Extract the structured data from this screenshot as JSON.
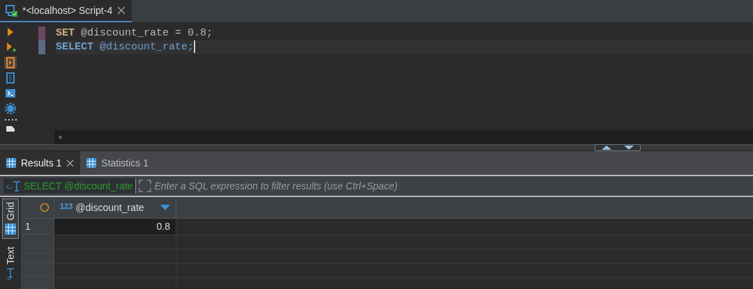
{
  "editor_tab": {
    "title": "*<localhost> Script-4",
    "selected": true
  },
  "code_lines": [
    {
      "current": false,
      "tokens": [
        {
          "kind": "keyword",
          "text": "SET"
        },
        {
          "kind": "text",
          "text": " @discount_rate = 0.8;"
        }
      ]
    },
    {
      "current": true,
      "tokens": [
        {
          "kind": "keyword",
          "text": "SELECT"
        },
        {
          "kind": "text",
          "text": " @discount_rate;"
        }
      ]
    }
  ],
  "result_tabs": [
    {
      "label": "Results 1",
      "selected": true
    },
    {
      "label": "Statistics 1",
      "selected": false
    }
  ],
  "filter": {
    "query": "SELECT @discount_rate",
    "placeholder": "Enter a SQL expression to filter results (use Ctrl+Space)"
  },
  "view_tabs": [
    {
      "label": "Grid",
      "selected": true
    },
    {
      "label": "Text",
      "selected": false
    }
  ],
  "grid": {
    "columns": [
      {
        "type_label": "123",
        "name": "@discount_rate"
      }
    ],
    "rows": [
      {
        "number": "1",
        "cells": [
          "0.8"
        ]
      }
    ]
  }
}
